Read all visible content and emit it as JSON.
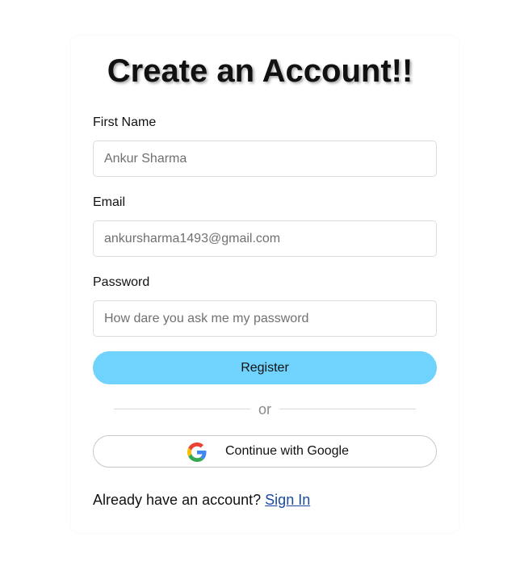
{
  "form": {
    "title": "Create an Account!!",
    "first_name": {
      "label": "First Name",
      "placeholder": "Ankur Sharma"
    },
    "email": {
      "label": "Email",
      "placeholder": "ankursharma1493@gmail.com"
    },
    "password": {
      "label": "Password",
      "placeholder": "How dare you ask me my password"
    },
    "register_label": "Register",
    "divider_text": "or",
    "google_label": "Continue with Google",
    "google_icon": "google-icon",
    "signin_prompt": "Already have an account?",
    "signin_link": "Sign In"
  },
  "colors": {
    "register_button": "#6fd3fe",
    "link": "#1a4aa3"
  }
}
